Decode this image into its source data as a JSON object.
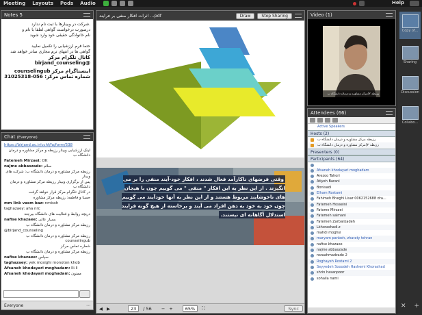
{
  "menubar": {
    "items": [
      "Meeting",
      "Layouts",
      "Pods",
      "Audio"
    ],
    "help": "Help"
  },
  "notes": {
    "title": "Notes 5",
    "lines": [
      ".شرکت در وبینارها با ثبت نام ندارد",
      "درصورت درخواست گواهی لطفا با نام و",
      "نام خانوادگی حقیقی خود وارد شوید",
      "",
      "حتما فرم ارزشیابی را تکمیل نمایید",
      "گواهی ها در انتهای ترم مجازی صادر خواهد شد",
      "کانال تلگرام مرکز @birjand_counseling",
      "",
      "اینستاگرام مرکز counselingub",
      "شماره تماس مرکز: 056-31025318"
    ]
  },
  "chat": {
    "title": "Chat",
    "audience": "(Everyone)",
    "messages": [
      {
        "name": "",
        "text": "https://birjand.ac.ir/cchf/fa/form/538",
        "link": true
      },
      {
        "name": "",
        "text": "لینک ارزشیابی وبینار رزیطه و مرکز مشاوره و درمان دانشگاه ب",
        "rtl": true
      },
      {
        "name": "Fatemeh Mirzaei:",
        "text": "OK"
      },
      {
        "name": "najme abbaszade:",
        "text": "سلام"
      },
      {
        "name": "",
        "text": "رزیطه مرکز مشاوره و درمان دانشگاه ب: شرکت های وبینار",
        "rtl": true
      },
      {
        "name": "",
        "text": "پس از برگزاری وبینار رزیطه مرکز مشاوره و درمان دانشگاه ب",
        "rtl": true
      },
      {
        "name": "",
        "text": "در کانال تلگرام مرکز قرار خواهد گرفت",
        "rtl": true
      },
      {
        "name": "",
        "text": "حسنا و فاطمه: رزیطه مرکز مشاوره",
        "rtl": true
      },
      {
        "name": "mm link vasm baz:",
        "text": "nmissh"
      },
      {
        "name": "",
        "text": "taghazaey: aha nrc",
        "rtl": false
      },
      {
        "name": "",
        "text": "دریچه روابط و فعالیت های دانشگاه بیرجند",
        "rtl": true
      },
      {
        "name": "nafise khazaee:",
        "text": "بسیار عالی"
      },
      {
        "name": "",
        "text": "رزیطه مرکز مشاوره و درمان دانشگاه ب",
        "rtl": true
      },
      {
        "name": "",
        "text": "@birjand_counseling",
        "rtl": false
      },
      {
        "name": "",
        "text": "رزیطه مرکز مشاوره و درمان دانشگاه ب counselingub",
        "rtl": true
      },
      {
        "name": "",
        "text": "شماره تماس مرکز",
        "rtl": true
      },
      {
        "name": "",
        "text": "رزیطه مرکز مشاوره و درمان دانشگاه ب",
        "rtl": true
      },
      {
        "name": "nafise khazaee:",
        "text": "سپاس"
      },
      {
        "name": "taghazaey:",
        "text": "yek mosighi monoton khob"
      },
      {
        "name": "Afsaneh khodayari moghadam:",
        "text": "lli.ll"
      },
      {
        "name": "Afsaneh khodayari moghadam:",
        "text": "ممنون"
      }
    ],
    "footer_left": "Everyone",
    "footer_right": "⋯"
  },
  "share": {
    "title": "اثرات افکار منفی بر فرایند ...pdf",
    "draw_label": "Draw",
    "stop_label": "Stop Sharing",
    "slide_text": "وقتی فرضهای ناکارآمد فعال شدند ، افکار خود-آیند منفی را بر می انگیزند . از این نظر به این افکار \" منفی \" می گوییم چون با هیجان های ناخوشایند مربوط هستند و از این نظر به آنها خودآیند می گوییم چون خود به خود به ذهن افراد می آیند و برخاسته از هیچ گونه فرایند استدلال آگاهانه ای نیستند.",
    "page": "23",
    "pages": "/ 56",
    "zoom": "65%",
    "sync_label": "Sync"
  },
  "video": {
    "title": "Video",
    "count": "(1)",
    "caption": "رزیطه ۲(مرکز مشاوره و درمان دانشگاه ب"
  },
  "attendees": {
    "title": "Attendees",
    "count": "(66)",
    "active_label": "Active Speakers",
    "hosts_label": "Hosts (2)",
    "presenters_label": "Presenters (0)",
    "participants_label": "Participants (64)",
    "hosts": [
      "رزیطه مرکز مشاوره و درمان دانشگاه ب",
      "رزیطه ۲(مرکز مشاوره و درمان دانشگاه ب"
    ],
    "participants": [
      {
        "name": "",
        "blue": true
      },
      {
        "name": "Afsaneh khodayari moghadam",
        "blue": true
      },
      {
        "name": "Arezoo Tahori"
      },
      {
        "name": "Atiyeh Barani"
      },
      {
        "name": "Bonisadi"
      },
      {
        "name": "Elham Rostami",
        "blue": true
      },
      {
        "name": "Fahimeh Bheghi Lisar 0062152688 dra...",
        "blue": false
      },
      {
        "name": "Fatemeh Hosseini"
      },
      {
        "name": "Fatome Mirzaei"
      },
      {
        "name": "Fatemeh salmani"
      },
      {
        "name": "Fatemeh Zarbalizadeh"
      },
      {
        "name": "Lkhorashadi.z"
      },
      {
        "name": "mahdi moghsi"
      },
      {
        "name": "maryam panbeh, zharaty tehran",
        "blue": true
      },
      {
        "name": "nafise khazaee"
      },
      {
        "name": "najme abbaszade"
      },
      {
        "name": "rezaahmadzade 2"
      },
      {
        "name": "Roghayeh Rostami 2",
        "blue": true
      },
      {
        "name": "Seyyedeh Sooodeh Hashemi Khorashad",
        "blue": true
      },
      {
        "name": "shrin hasanpoor"
      },
      {
        "name": "sohaila nami"
      }
    ]
  },
  "layouts": {
    "items": [
      "Copy of...",
      "Sharing",
      "Discussion",
      "Collabo..."
    ]
  }
}
